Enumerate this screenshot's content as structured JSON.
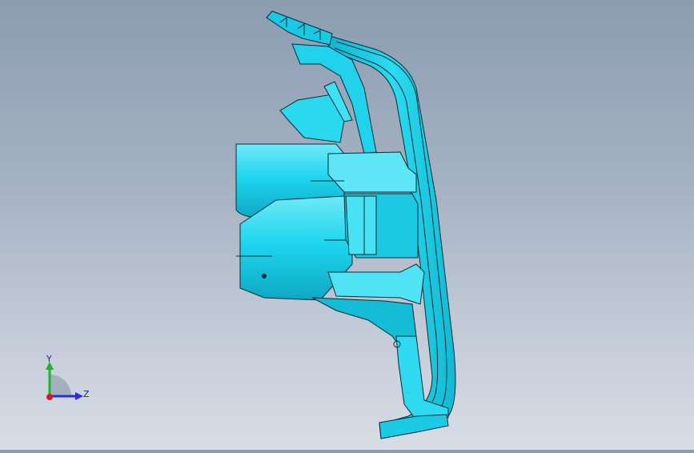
{
  "viewport": {
    "model_colors": {
      "face": "#1fd6ee",
      "face_light": "#8ef2fb",
      "face_dark": "#0fa9c7",
      "edge": "#0a2a33"
    }
  },
  "triad": {
    "y_label": "Y",
    "z_label": "Z",
    "colors": {
      "y": "#19b52a",
      "z": "#2a2fd6",
      "origin": "#d81a1a"
    }
  }
}
